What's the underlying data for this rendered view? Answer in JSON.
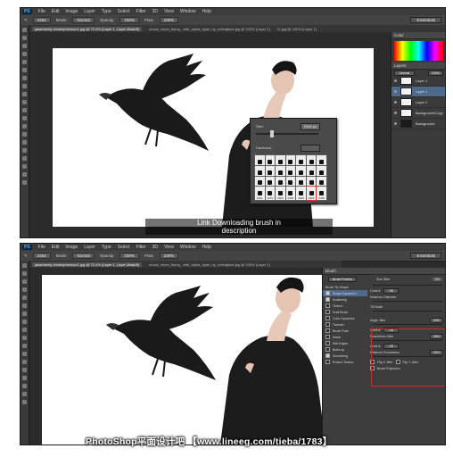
{
  "menu": [
    "PS",
    "File",
    "Edit",
    "Image",
    "Layer",
    "Type",
    "Select",
    "Filter",
    "3D",
    "View",
    "Window",
    "Help"
  ],
  "options_bar": {
    "mode_label": "Mode:",
    "mode_value": "Normal",
    "opacity_label": "Opacity:",
    "opacity_value": "100%",
    "flow_label": "Flow:",
    "flow_value": "100%",
    "brush_size": "2464",
    "workspace": "Essentials"
  },
  "tabs_top": [
    "jakarhemiy christophenson1.jpg @ 72.4% (Layer 1, Layer Mask/8)",
    "shock_raven_flamp_ with_alpha_layer_by_rottingface.jpg @ 100% (Layer 1)",
    "11.jpg @ 100% (Layer 1)"
  ],
  "tabs_bottom": [
    "jakarhemiy christophenson1.jpg @ 72.4% (Layer 1, Layer Mask/8)",
    "shock_raven_flamp_ with_alpha_layer_by_rottingface.jpg @ 100% (Layer 1)"
  ],
  "layers": {
    "blend": "Normal",
    "opacity": "100%",
    "items": [
      {
        "name": "Layer 1",
        "selected": false,
        "dark": false
      },
      {
        "name": "Layer 1",
        "selected": true,
        "dark": false
      },
      {
        "name": "Layer 2",
        "selected": false,
        "dark": false
      },
      {
        "name": "BackgroundCopy",
        "selected": false,
        "dark": false
      },
      {
        "name": "Background",
        "selected": false,
        "dark": true
      }
    ]
  },
  "brush_picker": {
    "size_label": "Size:",
    "size_value": "2464 px",
    "hardness_label": "Hardness:",
    "sizes": [
      "2401",
      "2374",
      "2326",
      "2496",
      "2463",
      "2464",
      "2462"
    ]
  },
  "caption": {
    "line1": "Link Downloading brush in",
    "line2": "description"
  },
  "brush_panel": {
    "title": "Brush",
    "presets_button": "Brush Presets",
    "size_jitter_label": "Size Jitter",
    "size_jitter_value": "0%",
    "tip_shape": "Brush Tip Shape",
    "options": [
      {
        "label": "Shape Dynamics",
        "on": true,
        "selected": true
      },
      {
        "label": "Scattering",
        "on": true,
        "selected": false
      },
      {
        "label": "Texture",
        "on": false,
        "selected": false
      },
      {
        "label": "Dual Brush",
        "on": false,
        "selected": false
      },
      {
        "label": "Color Dynamics",
        "on": false,
        "selected": false
      },
      {
        "label": "Transfer",
        "on": false,
        "selected": false
      },
      {
        "label": "Brush Pose",
        "on": false,
        "selected": false
      },
      {
        "label": "Noise",
        "on": false,
        "selected": false
      },
      {
        "label": "Wet Edges",
        "on": false,
        "selected": false
      },
      {
        "label": "Build-up",
        "on": false,
        "selected": false
      },
      {
        "label": "Smoothing",
        "on": true,
        "selected": false
      },
      {
        "label": "Protect Texture",
        "on": false,
        "selected": false
      }
    ],
    "control_label": "Control:",
    "control_value": "Off",
    "min_diameter": "Minimum Diameter",
    "tilt_scale": "Tilt Scale",
    "angle_jitter": "Angle Jitter",
    "angle_value": "34%",
    "roundness_jitter": "Roundness Jitter",
    "roundness_value": "26%",
    "min_roundness": "Minimum Roundness",
    "min_roundness_value": "25%",
    "flip_x": "Flip X Jitter",
    "flip_y": "Flip Y Jitter",
    "brush_projection": "Brush Projection"
  },
  "watermark": "PhotoShop平面设计吧 【www.lineeg.com/tieba/1783】"
}
